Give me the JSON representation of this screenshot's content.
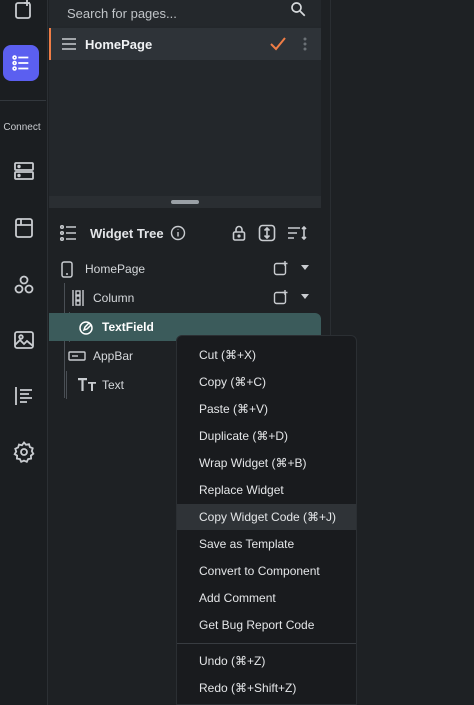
{
  "rail": {
    "connect_label": "Connect"
  },
  "pages": {
    "search_placeholder": "Search for pages...",
    "items": [
      {
        "label": "HomePage"
      }
    ]
  },
  "widget_tree": {
    "title": "Widget Tree",
    "nodes": [
      {
        "label": "HomePage"
      },
      {
        "label": "Column"
      },
      {
        "label": "TextField"
      },
      {
        "label": "AppBar"
      },
      {
        "label": "Text"
      }
    ]
  },
  "context_menu": {
    "items": [
      {
        "label": "Cut (⌘+X)"
      },
      {
        "label": "Copy (⌘+C)"
      },
      {
        "label": "Paste (⌘+V)"
      },
      {
        "label": "Duplicate (⌘+D)"
      },
      {
        "label": "Wrap Widget (⌘+B)"
      },
      {
        "label": "Replace Widget"
      },
      {
        "label": "Copy Widget Code (⌘+J)"
      },
      {
        "label": "Save as Template"
      },
      {
        "label": "Convert to Component"
      },
      {
        "label": "Add Comment"
      },
      {
        "label": "Get Bug Report Code"
      },
      {
        "label": "Undo (⌘+Z)"
      },
      {
        "label": "Redo (⌘+Shift+Z)"
      }
    ]
  },
  "colors": {
    "accent": "#5b5ff0",
    "page_highlight": "#ef7d46",
    "selected_row": "#3b5b5b"
  }
}
